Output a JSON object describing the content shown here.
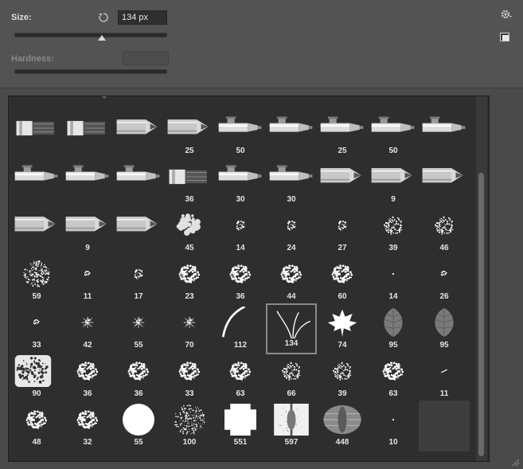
{
  "size": {
    "label": "Size:",
    "value": "134 px"
  },
  "hardness": {
    "label": "Hardness:"
  },
  "icons": {
    "reset": "reset-icon",
    "settings": "gear-icon",
    "menu": "panel-menu-icon",
    "resize": "resize-grip-icon"
  },
  "colors": {
    "panel": "#535353",
    "grid": "#2e2e2e",
    "field": "#2f2f2f",
    "text": "#e6e6e6"
  },
  "brushes": [
    {
      "type": "smear",
      "label": ""
    },
    {
      "type": "smear",
      "label": ""
    },
    {
      "type": "pencil",
      "label": ""
    },
    {
      "type": "pencil",
      "label": "25"
    },
    {
      "type": "marker",
      "label": "50"
    },
    {
      "type": "marker",
      "label": ""
    },
    {
      "type": "marker",
      "label": "25"
    },
    {
      "type": "marker",
      "label": "50"
    },
    {
      "type": "marker",
      "label": ""
    },
    {
      "type": "marker",
      "label": ""
    },
    {
      "type": "marker",
      "label": ""
    },
    {
      "type": "marker",
      "label": ""
    },
    {
      "type": "smear",
      "label": "36"
    },
    {
      "type": "marker",
      "label": "30"
    },
    {
      "type": "marker",
      "label": "30"
    },
    {
      "type": "pencil",
      "label": ""
    },
    {
      "type": "pencil",
      "label": "9"
    },
    {
      "type": "pencil",
      "label": ""
    },
    {
      "type": "pencil",
      "label": ""
    },
    {
      "type": "pencil",
      "label": "9"
    },
    {
      "type": "pencil",
      "label": ""
    },
    {
      "type": "soft",
      "label": "45"
    },
    {
      "type": "spray-s",
      "label": "14"
    },
    {
      "type": "spray-s",
      "label": "24"
    },
    {
      "type": "spray-s",
      "label": "27"
    },
    {
      "type": "spray-m",
      "label": "39"
    },
    {
      "type": "spray-m",
      "label": "46"
    },
    {
      "type": "spray-l",
      "label": "59"
    },
    {
      "type": "star-s",
      "label": "11"
    },
    {
      "type": "spray-s",
      "label": "17"
    },
    {
      "type": "chalk",
      "label": "23"
    },
    {
      "type": "chalk",
      "label": "36"
    },
    {
      "type": "chalk",
      "label": "44"
    },
    {
      "type": "chalk",
      "label": "60"
    },
    {
      "type": "dot",
      "label": "14"
    },
    {
      "type": "star-s",
      "label": "26"
    },
    {
      "type": "star-s",
      "label": "33"
    },
    {
      "type": "star",
      "label": "42"
    },
    {
      "type": "star",
      "label": "55"
    },
    {
      "type": "star",
      "label": "70"
    },
    {
      "type": "stroke",
      "label": "112"
    },
    {
      "type": "grass",
      "label": "134",
      "selected": true
    },
    {
      "type": "maple",
      "label": "74"
    },
    {
      "type": "leaf",
      "label": "95"
    },
    {
      "type": "leaf",
      "label": "95"
    },
    {
      "type": "texture",
      "label": "90"
    },
    {
      "type": "chalk",
      "label": "36"
    },
    {
      "type": "chalk",
      "label": "36"
    },
    {
      "type": "chalk",
      "label": "33"
    },
    {
      "type": "chalk",
      "label": "63"
    },
    {
      "type": "spray-m",
      "label": "66"
    },
    {
      "type": "spray-m",
      "label": "39"
    },
    {
      "type": "chalk",
      "label": "63"
    },
    {
      "type": "dash",
      "label": "11"
    },
    {
      "type": "chalk",
      "label": "48"
    },
    {
      "type": "chalk",
      "label": "32"
    },
    {
      "type": "circle",
      "label": "55"
    },
    {
      "type": "spatter",
      "label": "100"
    },
    {
      "type": "cross",
      "label": "551"
    },
    {
      "type": "pattern",
      "label": "597"
    },
    {
      "type": "pattern2",
      "label": "448"
    },
    {
      "type": "dot",
      "label": "10"
    },
    {
      "type": "empty",
      "label": ""
    }
  ]
}
